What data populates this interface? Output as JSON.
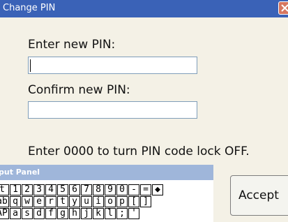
{
  "window": {
    "title": "Change PIN"
  },
  "form": {
    "new_pin_label": "Enter new PIN:",
    "new_pin_value": "",
    "confirm_pin_label": "Confirm new PIN:",
    "confirm_pin_value": "",
    "hint": "Enter 0000 to turn PIN code lock OFF."
  },
  "input_panel": {
    "title": "put Panel",
    "rows": [
      [
        "t",
        "1",
        "2",
        "3",
        "4",
        "5",
        "6",
        "7",
        "8",
        "9",
        "0",
        "-",
        "=",
        "◆"
      ],
      [
        "ab",
        "q",
        "w",
        "e",
        "r",
        "t",
        "y",
        "u",
        "i",
        "o",
        "p",
        "[",
        "]"
      ],
      [
        "AP",
        "a",
        "s",
        "d",
        "f",
        "g",
        "h",
        "j",
        "k",
        "l",
        ";",
        "'"
      ]
    ]
  },
  "buttons": {
    "accept": "Accept"
  },
  "colors": {
    "title_bar": "#3a62b7",
    "close": "#d6765f",
    "dialog_bg": "#f4f1e6",
    "panel_bar": "#9fb6da"
  }
}
